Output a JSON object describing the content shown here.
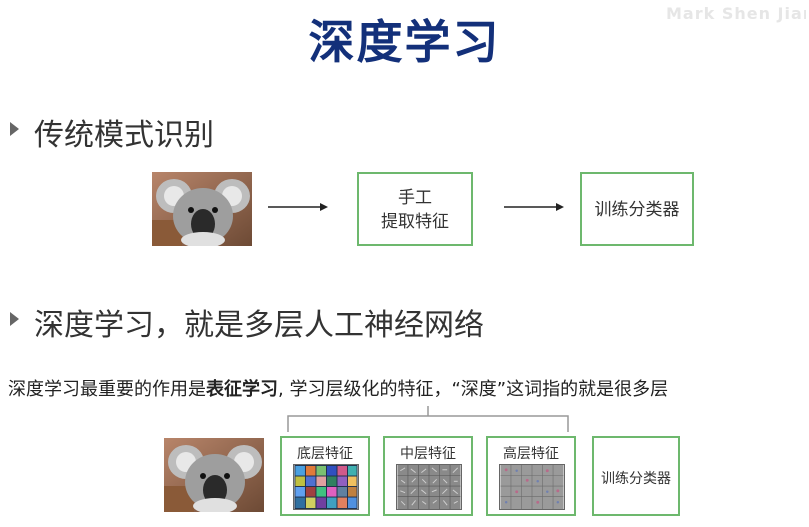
{
  "slide": {
    "title": "深度学习",
    "watermark": "Mark Shen Jian"
  },
  "section1": {
    "heading": "传统模式识别",
    "pipeline": {
      "feature_box": [
        "手工",
        "提取特征"
      ],
      "classifier_box": "训练分类器"
    }
  },
  "section2": {
    "heading": "深度学习，就是多层人工神经网络"
  },
  "description": {
    "part1": "深度学习最重要的作用是",
    "bold": "表征学习",
    "part2": ", 学习层级化的特征，“深度”这词指的就是很多层"
  },
  "layers": {
    "low": "底层特征",
    "mid": "中层特征",
    "high": "高层特征",
    "classifier": "训练分类器"
  },
  "colors": {
    "title": "#13307a",
    "box_border": "#6db86d",
    "bracket": "#999999"
  },
  "icons": {
    "bullet": "triangle-right-icon",
    "image": "koala-photo"
  }
}
